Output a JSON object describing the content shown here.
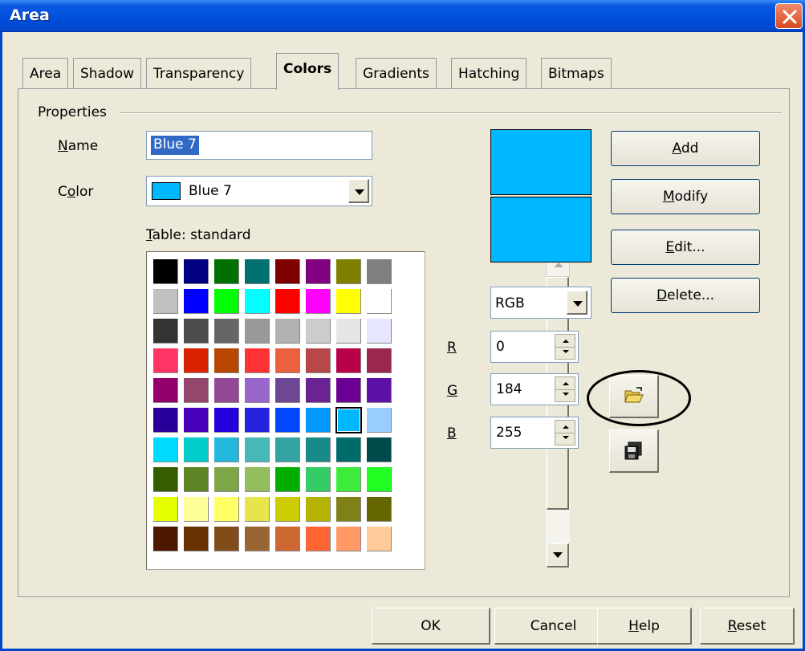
{
  "window": {
    "title": "Area"
  },
  "tabs": [
    {
      "label": "Area"
    },
    {
      "label": "Shadow"
    },
    {
      "label": "Transparency"
    },
    {
      "label": "Colors",
      "active": true
    },
    {
      "label": "Gradients"
    },
    {
      "label": "Hatching"
    },
    {
      "label": "Bitmaps"
    }
  ],
  "properties": {
    "group_label": "Properties",
    "name_label_u": "N",
    "name_label_rest": "ame",
    "name_value": "Blue 7",
    "color_label_pre": "C",
    "color_label_u": "o",
    "color_label_rest": "lor",
    "color_value": "Blue 7",
    "table_label_u": "T",
    "table_label_rest": "able: standard"
  },
  "palette": [
    [
      "#000000",
      "#000080",
      "#007000",
      "#007070",
      "#800000",
      "#800080",
      "#808000",
      "#808080"
    ],
    [
      "#c0c0c0",
      "#0000ff",
      "#00ff00",
      "#00ffff",
      "#ff0000",
      "#ff00ff",
      "#ffff00",
      "#ffffff"
    ],
    [
      "#333333",
      "#4d4d4d",
      "#666666",
      "#999999",
      "#b2b2b2",
      "#cccccc",
      "#e6e6e6",
      "#e6e6ff"
    ],
    [
      "#ff3366",
      "#dc2300",
      "#b84700",
      "#ff3333",
      "#eb613d",
      "#b84747",
      "#b80047",
      "#99284c"
    ],
    [
      "#94006b",
      "#94476b",
      "#944794",
      "#9966cc",
      "#6b4794",
      "#6b2394",
      "#6b0094",
      "#5e11a6"
    ],
    [
      "#280099",
      "#4700b8",
      "#2300dc",
      "#2323dc",
      "#0047ff",
      "#0099ff",
      "#00b8ff",
      "#99ccff"
    ],
    [
      "#00dcff",
      "#00cccc",
      "#23b8dc",
      "#47b8b8",
      "#33a3a3",
      "#198a8a",
      "#006b6b",
      "#004a4a"
    ],
    [
      "#355e00",
      "#5c8526",
      "#7da647",
      "#94bd5e",
      "#00ae00",
      "#33cc66",
      "#3deb3d",
      "#23ff23"
    ],
    [
      "#e6ff00",
      "#ffff99",
      "#ffff66",
      "#e6e64c",
      "#cccc00",
      "#b3b300",
      "#808019",
      "#666600"
    ],
    [
      "#4c1900",
      "#663300",
      "#804c19",
      "#996633",
      "#cc6633",
      "#ff6633",
      "#ff9966",
      "#ffcc99"
    ]
  ],
  "selected_color": "#00b8ff",
  "color_model": {
    "value": "RGB"
  },
  "rgb": {
    "r_label": "R",
    "r_value": "0",
    "g_label": "G",
    "g_value": "184",
    "b_label": "B",
    "b_value": "255"
  },
  "buttons": {
    "add_u": "A",
    "add_rest": "dd",
    "modify_u": "M",
    "modify_rest": "odify",
    "edit_u": "E",
    "edit_rest": "dit...",
    "delete_u": "D",
    "delete_rest": "elete..."
  },
  "icons": {
    "load": "open-folder-icon",
    "save": "save-disk-icon"
  },
  "footer": {
    "ok": "OK",
    "cancel": "Cancel",
    "help_u": "H",
    "help_rest": "elp",
    "reset_u": "R",
    "reset_rest": "eset"
  }
}
